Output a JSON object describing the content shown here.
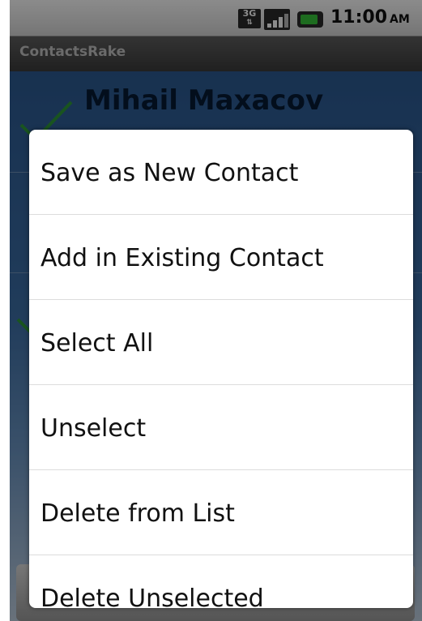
{
  "status_bar": {
    "network_type": "3G",
    "time": "11:00",
    "ampm": "AM",
    "icons": [
      "network-3g-icon",
      "signal-icon",
      "battery-charging-icon"
    ]
  },
  "app": {
    "title": "ContactsRake"
  },
  "contact": {
    "name": "Mihail Maxacov"
  },
  "menu": {
    "items": [
      {
        "label": "Save as New Contact"
      },
      {
        "label": "Add in Existing Contact"
      },
      {
        "label": "Select All"
      },
      {
        "label": "Unselect"
      },
      {
        "label": "Delete from List"
      },
      {
        "label": "Delete Unselected"
      }
    ]
  },
  "colors": {
    "title_bar": "#4a4a4a",
    "content_background": "#3c6ea6",
    "menu_background": "#ffffff",
    "checkmark": "#2e9a3a"
  }
}
